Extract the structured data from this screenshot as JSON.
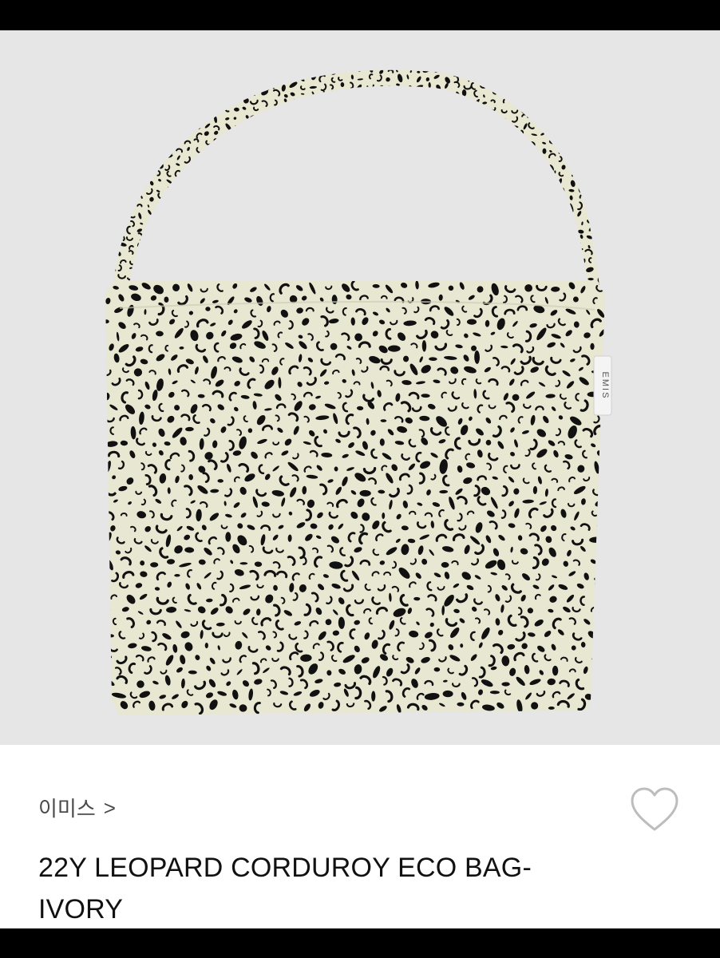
{
  "product": {
    "brand": "이미스",
    "brand_chevron": ">",
    "title": "22Y LEOPARD CORDUROY ECO BAG-IVORY",
    "label_tag": "EMIS",
    "wishlist_icon": "heart-outline-icon"
  },
  "colors": {
    "image_bg": "#e6e6e6",
    "bag_base": "#e7e7d2",
    "spots": "#111111",
    "text": "#111111",
    "subtext": "#4a4a4a",
    "heart": "#bdbdbd"
  }
}
